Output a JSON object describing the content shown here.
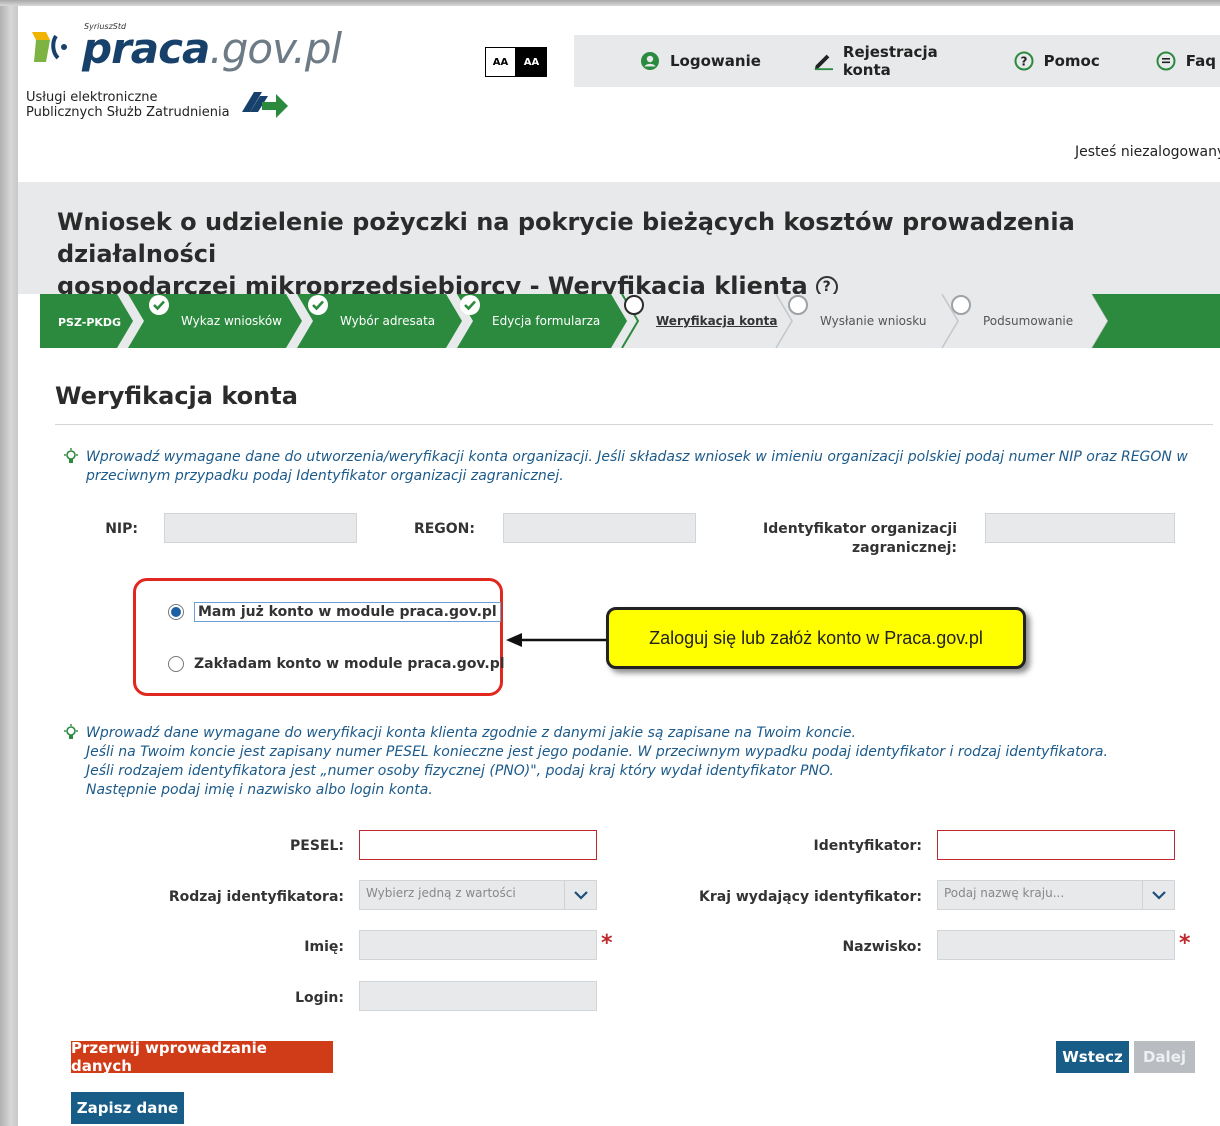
{
  "header": {
    "logo_superscript": "SyriuszStd",
    "logo_main": "praca",
    "logo_domain": ".gov.pl",
    "logo_desc_line1": "Usługi elektroniczne",
    "logo_desc_line2": "Publicznych Służb Zatrudnienia",
    "contrast_light": "AA",
    "contrast_dark": "AA",
    "nav": [
      {
        "label": "Logowanie",
        "icon": "user-circle-icon"
      },
      {
        "label": "Rejestracja konta",
        "icon": "pencil-icon"
      },
      {
        "label": "Pomoc",
        "icon": "help-circle-icon"
      },
      {
        "label": "Faq",
        "icon": "chat-bubble-icon"
      }
    ],
    "login_status": "Jesteś niezalogowany"
  },
  "title": {
    "line1": "Wniosek o udzielenie pożyczki na pokrycie bieżących kosztów prowadzenia działalności",
    "line2": "gospodarczej mikroprzedsiębiorcy - Weryfikacja klienta",
    "help_glyph": "?"
  },
  "stepper": {
    "code": "PSZ-PKDG",
    "steps": [
      {
        "label": "Wykaz wniosków",
        "state": "done"
      },
      {
        "label": "Wybór adresata",
        "state": "done"
      },
      {
        "label": "Edycja formularza",
        "state": "done"
      },
      {
        "label": "Weryfikacja konta",
        "state": "current"
      },
      {
        "label": "Wysłanie wniosku",
        "state": "pending"
      },
      {
        "label": "Podsumowanie",
        "state": "pending"
      }
    ],
    "colors": {
      "done": "#2b8a3e",
      "pending": "#e7e9eb"
    }
  },
  "section_title": "Weryfikacja konta",
  "hint1": {
    "line1": "Wprowadź wymagane dane do utworzenia/weryfikacji konta organizacji. Jeśli składasz wniosek w imieniu organizacji polskiej podaj numer NIP oraz REGON w",
    "line2": "przeciwnym przypadku podaj Identyfikator organizacji zagranicznej."
  },
  "org_fields": {
    "nip_label": "NIP:",
    "regon_label": "REGON:",
    "foreign_id_label_line1": "Identyfikator organizacji",
    "foreign_id_label_line2": "zagranicznej:"
  },
  "radios": {
    "has_account": "Mam już konto w module praca.gov.pl",
    "create_account": "Zakładam konto w module praca.gov.pl",
    "selected": "has_account"
  },
  "callout": "Zaloguj się lub załóż konto w Praca.gov.pl",
  "hint2": {
    "line1": "Wprowadź dane wymagane do weryfikacji konta klienta zgodnie z danymi jakie są zapisane na Twoim koncie.",
    "line2": "Jeśli na Twoim koncie jest zapisany numer PESEL konieczne jest jego podanie. W przeciwnym wypadku podaj identyfikator i rodzaj identyfikatora.",
    "line3": "Jeśli rodzajem identyfikatora jest „numer osoby fizycznej (PNO)\", podaj kraj który wydał identyfikator PNO.",
    "line4": "Następnie podaj imię i nazwisko albo login konta."
  },
  "person_fields": {
    "pesel_label": "PESEL:",
    "identyfikator_label": "Identyfikator:",
    "rodzaj_label": "Rodzaj identyfikatora:",
    "rodzaj_placeholder": "Wybierz jedną z wartości",
    "kraj_label": "Kraj wydający identyfikator:",
    "kraj_placeholder": "Podaj nazwę kraju...",
    "imie_label": "Imię:",
    "nazwisko_label": "Nazwisko:",
    "login_label": "Login:",
    "required_mark": "*"
  },
  "buttons": {
    "abort": "Przerwij wprowadzanie danych",
    "save": "Zapisz dane",
    "back": "Wstecz",
    "next": "Dalej"
  }
}
